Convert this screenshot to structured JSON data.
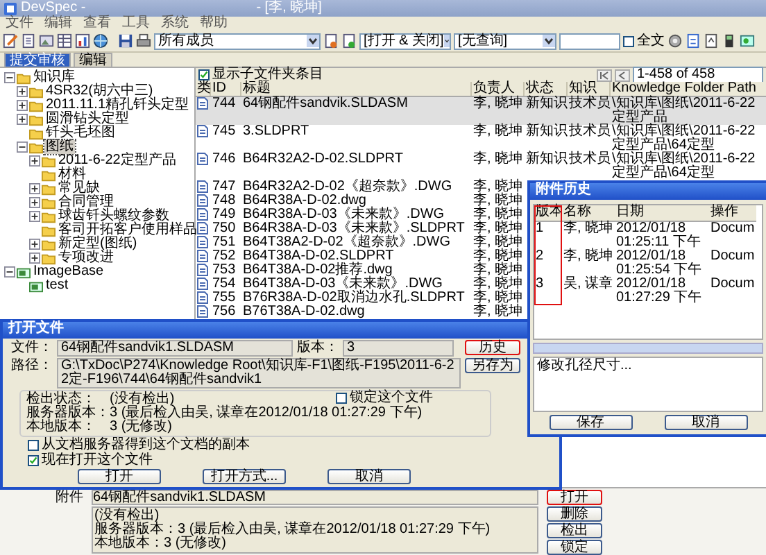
{
  "window": {
    "title": "DevSpec -",
    "user": "- [李, 晓坤]"
  },
  "menu": [
    "文件",
    "编辑",
    "查看",
    "工具",
    "系统",
    "帮助"
  ],
  "toolbar": {
    "member_filter": "所有成员",
    "state_filter": "[打开 & 关闭]",
    "query_filter": "[无查询]",
    "fulltext": {
      "label": "全文",
      "checked": false
    }
  },
  "tabs": [
    {
      "label": "提交审核",
      "selected": true
    },
    {
      "label": "编辑",
      "selected": false
    }
  ],
  "tree": [
    {
      "label": "知识库",
      "kind": "folder",
      "expanded": true,
      "selected": false,
      "children": [
        {
          "label": "4SR32(胡六中三)",
          "kind": "folder",
          "expanded": false,
          "selected": false
        },
        {
          "label": "2011.11.1精孔钎头定型",
          "kind": "folder",
          "expanded": false,
          "selected": false
        },
        {
          "label": "圆滑钻头定型",
          "kind": "folder",
          "expanded": false,
          "selected": false
        },
        {
          "label": "钎头毛坯图",
          "kind": "folder",
          "selected": false
        },
        {
          "label": "图纸",
          "kind": "folder",
          "expanded": true,
          "selected": true,
          "children": [
            {
              "label": "2011-6-22定型产品",
              "kind": "folder",
              "expanded": false,
              "selected": false
            },
            {
              "label": "材料",
              "kind": "folder",
              "selected": false
            },
            {
              "label": "常见缺",
              "kind": "folder",
              "expanded": false,
              "selected": false
            },
            {
              "label": "合同管理",
              "kind": "folder",
              "expanded": false,
              "selected": false
            },
            {
              "label": "球齿钎头螺纹参数",
              "kind": "folder",
              "expanded": false,
              "selected": false
            },
            {
              "label": "客司开拓客户使用样品",
              "kind": "folder",
              "selected": false
            },
            {
              "label": "新定型(图纸)",
              "kind": "folder",
              "expanded": false,
              "selected": false
            },
            {
              "label": "专项改进",
              "kind": "folder",
              "expanded": false,
              "selected": false
            }
          ]
        }
      ]
    },
    {
      "label": "ImageBase",
      "kind": "library",
      "expanded": true,
      "selected": false,
      "children": [
        {
          "label": "test",
          "kind": "library",
          "selected": false
        }
      ]
    }
  ],
  "list": {
    "show_subfolders": {
      "label": "显示子文件夹条目",
      "checked": true
    },
    "pager": "1-458 of 458",
    "columns": [
      "类",
      "ID",
      "标题",
      "负责人",
      "状态",
      "知识",
      "Knowledge Folder Path"
    ],
    "rows": [
      {
        "id": "744",
        "title": "64钢配件sandvik.SLDASM",
        "owner": "李, 晓坤",
        "status": "新知识",
        "knowledge": "技术员",
        "path": "\\知识库\\图纸\\2011-6-22定型产品",
        "selected": true
      },
      {
        "id": "745",
        "title": "3.SLDPRT",
        "owner": "李, 晓坤",
        "status": "新知识",
        "knowledge": "技术员",
        "path": "\\知识库\\图纸\\2011-6-22定型产品\\64定型",
        "selected": false
      },
      {
        "id": "746",
        "title": "B64R32A2-D-02.SLDPRT",
        "owner": "李, 晓坤",
        "status": "新知识",
        "knowledge": "技术员",
        "path": "\\知识库\\图纸\\2011-6-22定型产品\\64定型",
        "selected": false
      },
      {
        "id": "747",
        "title": "B64R32A2-D-02《超奈款》.DWG",
        "owner": "李, 晓坤",
        "selected": false
      },
      {
        "id": "748",
        "title": "B64R38A-D-02.dwg",
        "owner": "李, 晓坤",
        "selected": false
      },
      {
        "id": "749",
        "title": "B64R38A-D-03《未来款》.DWG",
        "owner": "李, 晓坤",
        "selected": false
      },
      {
        "id": "750",
        "title": "B64R38A-D-03《未来款》.SLDPRT",
        "owner": "李, 晓坤",
        "selected": false
      },
      {
        "id": "751",
        "title": "B64T38A2-D-02《超奈款》.DWG",
        "owner": "李, 晓坤",
        "selected": false
      },
      {
        "id": "752",
        "title": "B64T38A-D-02.SLDPRT",
        "owner": "李, 晓坤",
        "selected": false
      },
      {
        "id": "753",
        "title": "B64T38A-D-02推荐.dwg",
        "owner": "李, 晓坤",
        "selected": false
      },
      {
        "id": "754",
        "title": "B64T38A-D-03《未来款》.DWG",
        "owner": "李, 晓坤",
        "selected": false
      },
      {
        "id": "755",
        "title": "B76R38A-D-02取消边水孔.SLDPRT",
        "owner": "李, 晓坤",
        "selected": false
      },
      {
        "id": "756",
        "title": "B76T38A-D-02.dwg",
        "owner": "李, 晓坤",
        "selected": false
      }
    ]
  },
  "open_dialog": {
    "title": "打开文件",
    "file_label": "文件：",
    "file": "64钢配件sandvik1.SLDASM",
    "version_label": "版本：",
    "version": "3",
    "path_label": "路径：",
    "path": "G:\\TxDoc\\P274\\Knowledge Root\\知识库-F1\\图纸-F195\\2011-6-22定-F196\\744\\64钢配件sandvik1",
    "status": [
      {
        "label": "检出状态：",
        "value": "(没有检出)"
      },
      {
        "label": "服务器版本：",
        "value": "3 (最后检入由吴, 谋章在2012/01/18 01:27:29 下午)"
      },
      {
        "label": "本地版本：",
        "value": "3 (无修改)"
      }
    ],
    "lock": {
      "label": "锁定这个文件",
      "checked": false
    },
    "options": [
      {
        "label": "从文档服务器得到这个文档的副本",
        "checked": false
      },
      {
        "label": "现在打开这个文件",
        "checked": true
      }
    ],
    "side_buttons": [
      {
        "label": "历史",
        "highlighted": true
      },
      {
        "label": "另存为",
        "highlighted": false
      }
    ],
    "buttons": [
      "打开",
      "打开方式...",
      "取消"
    ]
  },
  "history_dialog": {
    "title": "附件历史",
    "columns": [
      {
        "label": "版本",
        "highlighted": true
      },
      {
        "label": "名称",
        "highlighted": false
      },
      {
        "label": "日期",
        "highlighted": false
      },
      {
        "label": "操作",
        "highlighted": false
      }
    ],
    "rows": [
      {
        "version": "1",
        "name": "李, 晓坤",
        "date": "2012/01/18 01:25:11 下午",
        "action": "Docum"
      },
      {
        "version": "2",
        "name": "李, 晓坤",
        "date": "2012/01/18 01:25:54 下午",
        "action": "Docum"
      },
      {
        "version": "3",
        "name": "吴, 谋章",
        "date": "2012/01/18 01:27:29 下午",
        "action": "Docum"
      }
    ],
    "comment": "修改孔径尺寸...",
    "buttons": [
      "保存",
      "取消"
    ]
  },
  "attachment_panel": {
    "label": "附件",
    "file": "64钢配件sandvik1.SLDASM",
    "details": [
      "(没有检出)",
      "服务器版本：3 (最后检入由吴, 谋章在2012/01/18 01:27:29 下午)",
      "本地版本：3 (无修改)"
    ],
    "buttons": [
      {
        "label": "打开",
        "highlighted": true
      },
      {
        "label": "删除",
        "highlighted": false
      },
      {
        "label": "检出",
        "highlighted": false
      },
      {
        "label": "锁定",
        "highlighted": false
      }
    ]
  }
}
